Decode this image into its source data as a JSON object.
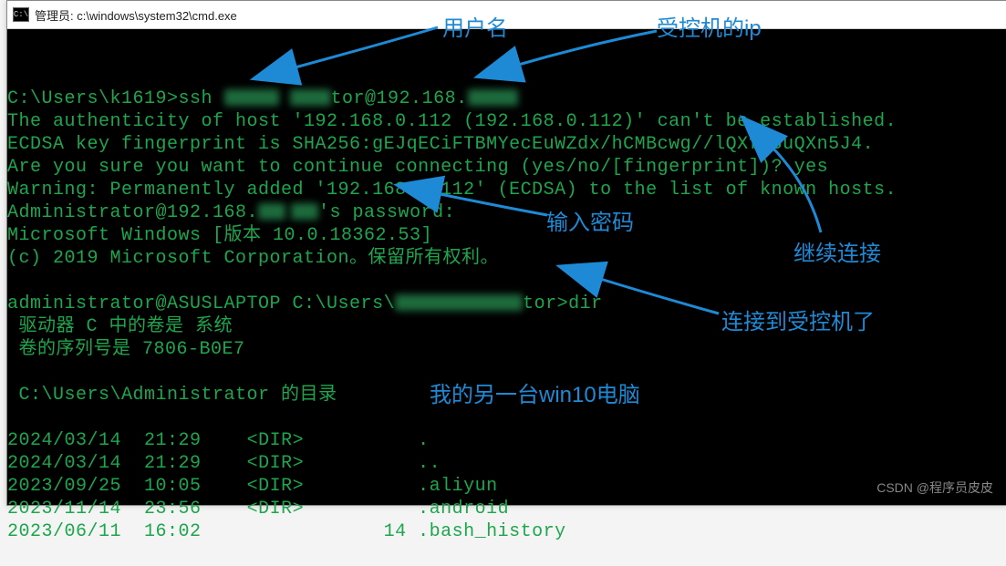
{
  "window": {
    "title": "管理员: c:\\windows\\system32\\cmd.exe"
  },
  "term": {
    "prompt1": "C:\\Users\\k1619>",
    "cmd1_a": "ssh ",
    "cmd1_b": "tor@192.168.",
    "l2": "The authenticity of host '192.168.0.112 (192.168.0.112)' can't be established.",
    "l3": "ECDSA key fingerprint is SHA256:gEJqECiFTBMYecEuWZdx/hCMBcwg//lQXf9UuQXn5J4.",
    "l4": "Are you sure you want to continue connecting (yes/no/[fingerprint])? yes",
    "l5": "Warning: Permanently added '192.168.0.112' (ECDSA) to the list of known hosts.",
    "l6a": "Administrator@192.168.",
    "l6b": "'s password:",
    "l7": "Microsoft Windows [版本 10.0.18362.53]",
    "l8": "(c) 2019 Microsoft Corporation。保留所有权利。",
    "p2a": "administrator@ASUSLAPTOP C:\\Users\\",
    "p2b": "tor>",
    "cmd2": "dir",
    "l9": " 驱动器 C 中的卷是 系统",
    "l10": " 卷的序列号是 7806-B0E7",
    "l11": " C:\\Users\\Administrator 的目录",
    "rows": [
      {
        "date": "2024/03/14",
        "time": "21:29",
        "tag": "<DIR>",
        "name": "."
      },
      {
        "date": "2024/03/14",
        "time": "21:29",
        "tag": "<DIR>",
        "name": ".."
      },
      {
        "date": "2023/09/25",
        "time": "10:05",
        "tag": "<DIR>",
        "name": ".aliyun"
      },
      {
        "date": "2023/11/14",
        "time": "23:56",
        "tag": "<DIR>",
        "name": ".android"
      },
      {
        "date": "2023/06/11",
        "time": "16:02",
        "tag": "",
        "size": "14",
        "name": ".bash_history"
      }
    ]
  },
  "annotations": {
    "user": "用户名",
    "ip": "受控机的ip",
    "pw": "输入密码",
    "cont": "继续连接",
    "conn": "连接到受控机了",
    "mine": "我的另一台win10电脑"
  },
  "watermark": "CSDN @程序员皮皮"
}
